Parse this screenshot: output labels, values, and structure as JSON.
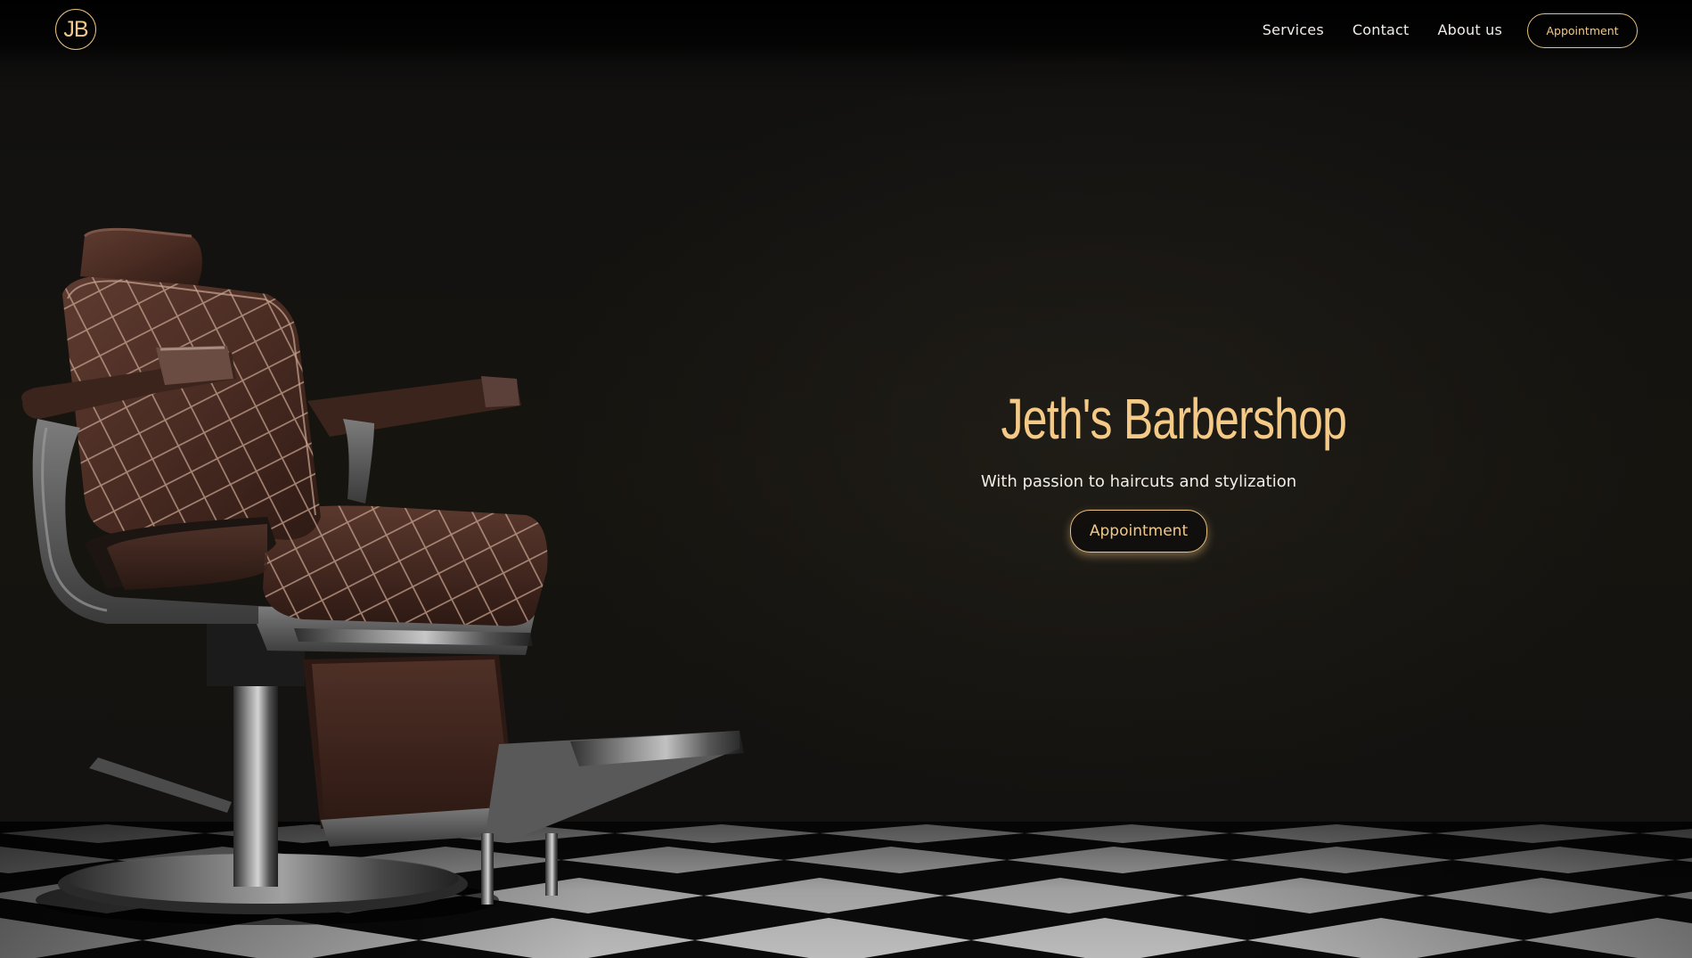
{
  "navbar": {
    "logo_text": "JB",
    "links": [
      {
        "label": "Services"
      },
      {
        "label": "Contact"
      },
      {
        "label": "About us"
      }
    ],
    "appointment_label": "Appointment"
  },
  "hero": {
    "title": "Jeth's Barbershop",
    "subtitle": "With passion to haircuts and stylization",
    "appointment_label": "Appointment"
  },
  "colors": {
    "accent": "#f0c98a",
    "background": "#141210",
    "text": "#f1ede6"
  }
}
